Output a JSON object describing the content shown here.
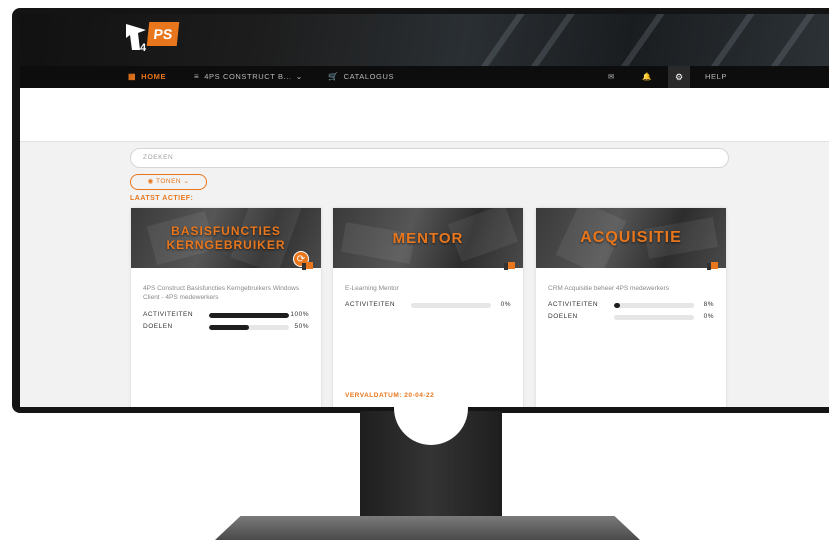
{
  "nav": {
    "home": "HOME",
    "construct": "4PS CONSTRUCT B...",
    "catalog": "CATALOGUS",
    "help": "HELP"
  },
  "logo": {
    "text": "PS",
    "number": "4"
  },
  "search": {
    "placeholder": "ZOEKEN"
  },
  "filter": {
    "label": "TONEN"
  },
  "recent": {
    "label": "LAATST ACTIEF:"
  },
  "colors": {
    "accent": "#e8761c",
    "dark": "#0d0d0d"
  },
  "cards": [
    {
      "title": "BASISFUNCTIES KERNGEBRUIKER",
      "tags": "4PS Construct Basisfuncties   Kerngebruikers   Windows Client - 4PS medewerkers",
      "activities_label": "ACTIVITEITEN",
      "activities_pct": "100%",
      "activities_value": 1.0,
      "goals_label": "DOELEN",
      "goals_pct": "50%",
      "goals_value": 0.5
    },
    {
      "title": "MENTOR",
      "tags": "E-Learning Mentor",
      "activities_label": "ACTIVITEITEN",
      "activities_pct": "0%",
      "activities_value": 0,
      "due": "VERVALDATUM: 20-04-22"
    },
    {
      "title": "ACQUISITIE",
      "tags": "CRM   Acquisitie beheer   4PS medewerkers",
      "activities_label": "ACTIVITEITEN",
      "activities_pct": "8%",
      "activities_value": 0.08,
      "goals_label": "DOELEN",
      "goals_pct": "0%",
      "goals_value": 0
    }
  ]
}
